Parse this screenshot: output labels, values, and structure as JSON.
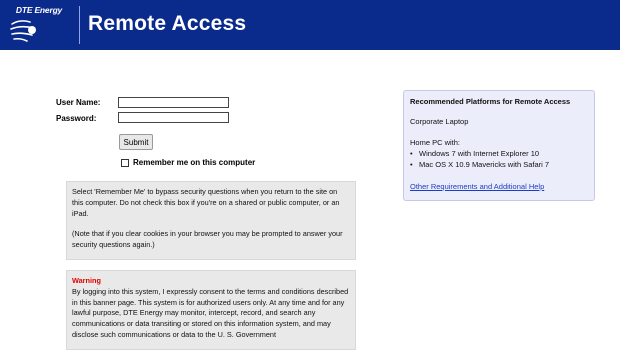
{
  "header": {
    "logo_text": "DTE Energy",
    "title": "Remote Access"
  },
  "login": {
    "username_label": "User Name:",
    "username_value": "",
    "password_label": "Password:",
    "password_value": "",
    "submit_label": "Submit",
    "remember_label": "Remember me on this computer",
    "remember_checked": false
  },
  "remember_info": {
    "paragraph1": "Select 'Remember Me' to bypass security questions when you return to the site on this computer. Do not check this box if you're on a shared or public computer, or an iPad.",
    "paragraph2": "(Note that if you clear cookies in your browser you may be prompted to answer your security questions again.)"
  },
  "warning": {
    "title": "Warning",
    "body": "By logging into this system, I expressly consent to the terms and conditions described in this banner page. This system is for authorized users only. At any time and for any lawful purpose, DTE Energy may monitor, intercept, record, and search any communications or data transiting or stored on this information system, and may disclose such communications or data to the U. S. Government"
  },
  "platforms": {
    "title": "Recommended Platforms for Remote Access",
    "corporate": "Corporate Laptop",
    "home_heading": "Home PC with:",
    "items": [
      "Windows 7 with Internet Explorer 10",
      "Mac OS X 10.9 Mavericks with Safari 7"
    ],
    "help_link": "Other Requirements and Additional Help"
  },
  "colors": {
    "header_bg": "#0a2a8c",
    "warning": "#e00000",
    "link": "#1a3cc8",
    "platform_box_bg": "#ecedfa",
    "info_box_bg": "#e9e9e9"
  }
}
